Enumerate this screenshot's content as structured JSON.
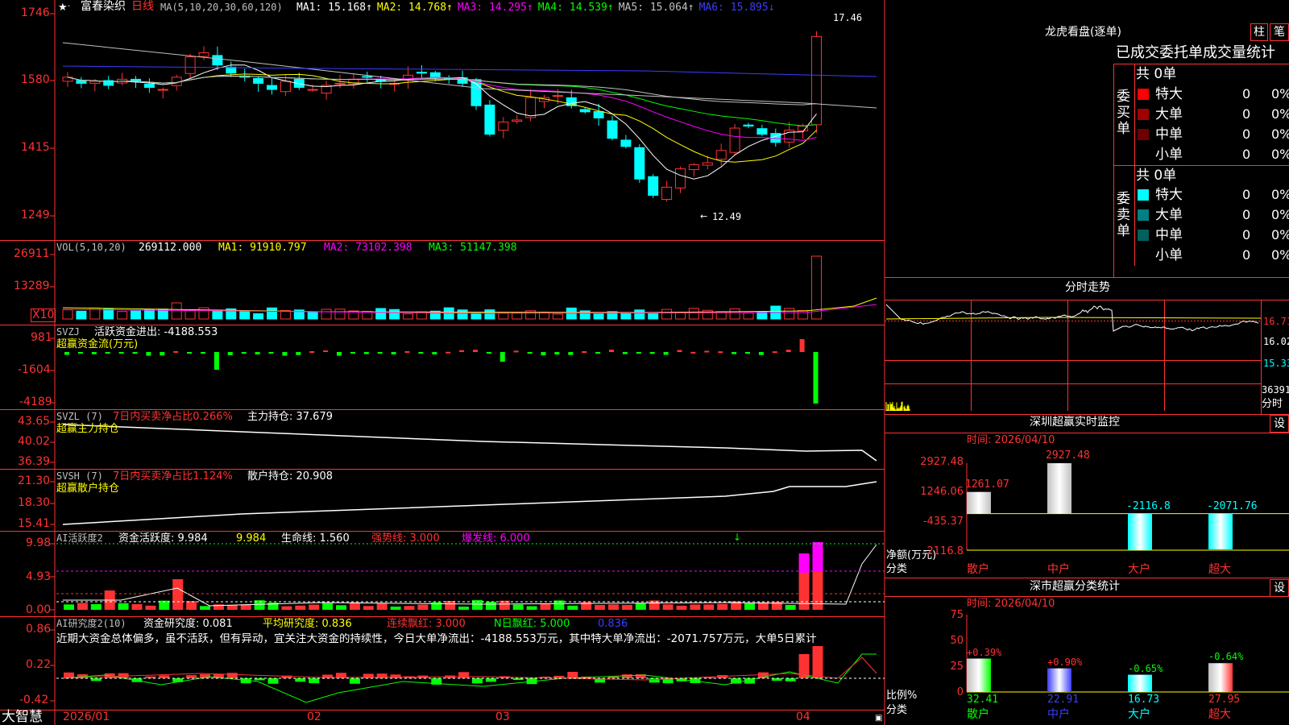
{
  "header": {
    "stock_name": "富春染织",
    "period": "日线",
    "ma_label": "MA(5,10,20,30,60,120)",
    "ma": [
      {
        "name": "MA1:",
        "value": "15.168",
        "color": "#ffffff"
      },
      {
        "name": "MA2:",
        "value": "14.768",
        "color": "#ffff00"
      },
      {
        "name": "MA3:",
        "value": "14.295",
        "color": "#ff00ff"
      },
      {
        "name": "MA4:",
        "value": "14.539",
        "color": "#00ff00"
      },
      {
        "name": "MA5:",
        "value": "15.064",
        "color": "#c0c0c0"
      },
      {
        "name": "MA6:",
        "value": "15.895",
        "color": "#3c3cff"
      }
    ]
  },
  "price_axis": [
    "1746",
    "1580",
    "1415",
    "1249"
  ],
  "price_annotations": {
    "high": "17.46",
    "low": "12.49"
  },
  "vol": {
    "label": "VOL(5,10,20)",
    "value": "269112.000",
    "ma1": "MA1: 91910.797",
    "ma2": "MA2: 73102.398",
    "ma3": "MA3: 51147.398",
    "axis": [
      "26911",
      "13289"
    ],
    "unit": "X10"
  },
  "svzj": {
    "label": "SVZJ",
    "text": "活跃资金进出: -4188.553",
    "sub": "超赢资金流(万元)",
    "axis": [
      "981",
      "-1604",
      "-4189"
    ]
  },
  "svzl": {
    "label": "SVZL (7)",
    "ratio": "7日内买卖净占比0.266%",
    "hold": "主力持仓: 37.679",
    "sub": "超赢主力持仓",
    "axis": [
      "43.65",
      "40.02",
      "36.39"
    ]
  },
  "svsh": {
    "label": "SVSH (7)",
    "ratio": "7日内买卖净占比1.124%",
    "hold": "散户持仓: 20.908",
    "sub": "超赢散户持仓",
    "axis": [
      "21.30",
      "18.30",
      "15.41"
    ]
  },
  "ai1": {
    "label": "AI活跃度2",
    "a": "资金活跃度: 9.984",
    "b": "9.984",
    "c": "生命线: 1.560",
    "d": "强势线: 3.000",
    "e": "爆发线: 6.000",
    "axis": [
      "9.98",
      "4.93",
      "0.00"
    ]
  },
  "ai2": {
    "label": "AI研究度2(10)",
    "a": "资金研究度: 0.081",
    "b": "平均研究度: 0.836",
    "c": "连续飘红: 3.000",
    "d": "N日飘红: 5.000",
    "e": "0.836",
    "axis": [
      "0.86",
      "0.22",
      "-0.42"
    ],
    "comment": "近期大资金总体偏多，虽不活跃，但有异动，宜关注大资金的持续性，今日大单净流出：-4188.553万元，其中特大单净流出：-2071.757万元，大单5日累计"
  },
  "time_axis": [
    "2026/01",
    "02",
    "03",
    "04"
  ],
  "brand": "大智慧",
  "right": {
    "lhb_title": "龙虎看盘(逐单)",
    "btn1": "柱",
    "btn2": "笔",
    "lhb_header": "已成交委托单成交量统计",
    "buy_side": "委买单",
    "sell_side": "委卖单",
    "buy_total": "共 0单",
    "sell_total": "共 0单",
    "buy_rows": [
      {
        "label": "特大",
        "v": "0",
        "p": "0%",
        "c": "#ff0000"
      },
      {
        "label": "大单",
        "v": "0",
        "p": "0%",
        "c": "#a00000"
      },
      {
        "label": "中单",
        "v": "0",
        "p": "0%",
        "c": "#700000"
      },
      {
        "label": "小单",
        "v": "0",
        "p": "0%",
        "c": "#000000"
      }
    ],
    "sell_rows": [
      {
        "label": "特大",
        "v": "0",
        "p": "0%",
        "c": "#00ffff"
      },
      {
        "label": "大单",
        "v": "0",
        "p": "0%",
        "c": "#008080"
      },
      {
        "label": "中单",
        "v": "0",
        "p": "0%",
        "c": "#006060"
      },
      {
        "label": "小单",
        "v": "0",
        "p": "0%",
        "c": "#000000"
      }
    ],
    "fs_title": "分时走势",
    "fs_axis": [
      "16.71",
      "16.02",
      "15.33",
      "36391"
    ],
    "fs_unit": "分时",
    "sz_title": "深圳超赢实时监控",
    "sz_btn": "设",
    "sz_time": "时间: 2026/04/10",
    "sz_axis": [
      "2927.48",
      "1246.06",
      "-435.37",
      "-2116.8"
    ],
    "sz_ylabel": "净额(万元)",
    "sz_xlabel": "分类",
    "sz_bars": [
      {
        "cat": "散户",
        "val": "1261.07"
      },
      {
        "cat": "中户",
        "val": "2927.48"
      },
      {
        "cat": "大户",
        "val": "-2116.8"
      },
      {
        "cat": "超大",
        "val": "-2071.76"
      }
    ],
    "sc_title": "深市超赢分类统计",
    "sc_btn": "设",
    "sc_time": "时间: 2026/04/10",
    "sc_axis": [
      "75",
      "50",
      "25",
      "0"
    ],
    "sc_ylabel": "比例%",
    "sc_xlabel": "分类",
    "sc_bars": [
      {
        "cat": "散户",
        "val": "32.41",
        "chg": "+0.39%"
      },
      {
        "cat": "中户",
        "val": "22.91",
        "chg": "+0.90%"
      },
      {
        "cat": "大户",
        "val": "16.73",
        "chg": "-0.65%"
      },
      {
        "cat": "超大",
        "val": "27.95",
        "chg": "-0.64%"
      }
    ]
  },
  "chart_data": [
    {
      "type": "bar",
      "title": "深圳超赢实时监控",
      "ylabel": "净额(万元)",
      "xlabel": "分类",
      "categories": [
        "散户",
        "中户",
        "大户",
        "超大"
      ],
      "values": [
        1261.07,
        2927.48,
        -2116.8,
        -2071.76
      ],
      "ylim": [
        -2116.8,
        2927.48
      ]
    },
    {
      "type": "bar",
      "title": "深市超赢分类统计",
      "ylabel": "比例%",
      "xlabel": "分类",
      "categories": [
        "散户",
        "中户",
        "大户",
        "超大"
      ],
      "values": [
        32.41,
        22.91,
        16.73,
        27.95
      ],
      "ylim": [
        0,
        75
      ]
    }
  ]
}
